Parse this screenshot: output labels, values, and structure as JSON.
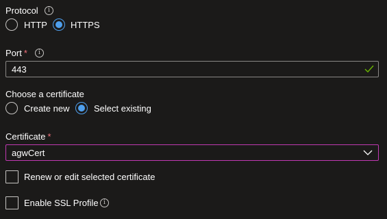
{
  "protocol": {
    "label": "Protocol",
    "info_icon": "info-icon",
    "options": [
      {
        "label": "HTTP",
        "checked": false
      },
      {
        "label": "HTTPS",
        "checked": true
      }
    ]
  },
  "port": {
    "label": "Port",
    "required_mark": "*",
    "info_icon": "info-icon",
    "value": "443",
    "valid_icon": "checkmark-icon"
  },
  "certificate_choice": {
    "label": "Choose a certificate",
    "options": [
      {
        "label": "Create new",
        "checked": false
      },
      {
        "label": "Select existing",
        "checked": true
      }
    ]
  },
  "certificate": {
    "label": "Certificate",
    "required_mark": "*",
    "selected_value": "agwCert",
    "dropdown_icon": "chevron-down-icon"
  },
  "checkboxes": [
    {
      "label": "Renew or edit selected certificate",
      "checked": false
    },
    {
      "label": "Enable SSL Profile",
      "checked": false,
      "info_icon": "info-icon"
    }
  ],
  "colors": {
    "background": "#1b1a19",
    "accent": "#4f9fec",
    "required": "#f1707b",
    "valid_check": "#6bb700",
    "dropdown_focus_border": "#c239b3",
    "field_border": "#8a8886"
  }
}
